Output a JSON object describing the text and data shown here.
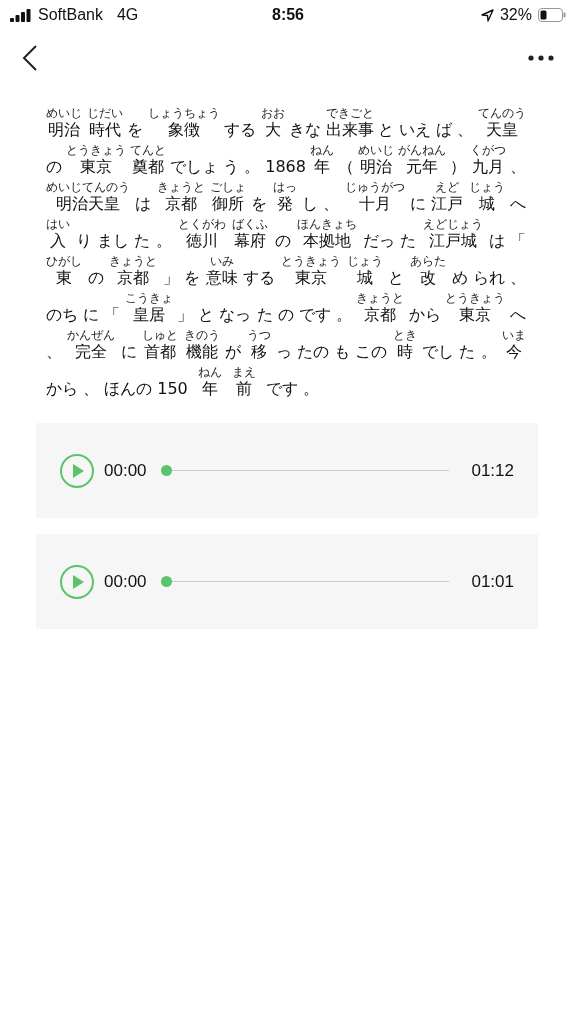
{
  "status_bar": {
    "carrier": "SoftBank",
    "network": "4G",
    "time": "8:56",
    "battery": "32%"
  },
  "article": {
    "lines": [
      [
        {
          "text": "明治",
          "ruby": "めいじ"
        },
        {
          "text": "時代",
          "ruby": "じだい"
        },
        {
          "text": "を"
        },
        {
          "text": "象徴",
          "ruby": "しょうちょう"
        },
        {
          "text": "する"
        },
        {
          "text": "大",
          "ruby": "おお"
        },
        {
          "text": "きな"
        },
        {
          "text": "出来事",
          "ruby": "できごと"
        },
        {
          "text": "と いえ ば 、"
        },
        {
          "text": "天皇",
          "ruby": "てんのう"
        }
      ],
      [
        {
          "text": "の"
        },
        {
          "text": "東京",
          "ruby": "とうきょう"
        },
        {
          "text": "奠都",
          "ruby": "てんと"
        },
        {
          "text": "でしょ う 。 1868"
        },
        {
          "text": "年",
          "ruby": "ねん"
        },
        {
          "text": "（"
        },
        {
          "text": "明治",
          "ruby": "めいじ"
        },
        {
          "text": "元年",
          "ruby": "がんねん"
        },
        {
          "text": "）"
        },
        {
          "text": "九月",
          "ruby": "くがつ"
        },
        {
          "text": "、"
        }
      ],
      [
        {
          "text": "明治天皇",
          "ruby": "めいじてんのう"
        },
        {
          "text": "は"
        },
        {
          "text": "京都",
          "ruby": "きょうと"
        },
        {
          "text": "御所",
          "ruby": "ごしょ"
        },
        {
          "text": "を"
        },
        {
          "text": "発",
          "ruby": "はっ"
        },
        {
          "text": "し 、"
        },
        {
          "text": "十月",
          "ruby": "じゅうがつ"
        },
        {
          "text": "に"
        },
        {
          "text": "江戸",
          "ruby": "えど"
        },
        {
          "text": "城",
          "ruby": "じょう"
        },
        {
          "text": "へ"
        }
      ],
      [
        {
          "text": "入",
          "ruby": "はい"
        },
        {
          "text": "り まし た 。"
        },
        {
          "text": "徳川",
          "ruby": "とくがわ"
        },
        {
          "text": "幕府",
          "ruby": "ばくふ"
        },
        {
          "text": "の"
        },
        {
          "text": "本拠地",
          "ruby": "ほんきょち"
        },
        {
          "text": "だっ た"
        },
        {
          "text": "江戸城",
          "ruby": "えどじょう"
        },
        {
          "text": "は 「"
        }
      ],
      [
        {
          "text": "東",
          "ruby": "ひがし"
        },
        {
          "text": "の"
        },
        {
          "text": "京都",
          "ruby": "きょうと"
        },
        {
          "text": "」 を"
        },
        {
          "text": "意味",
          "ruby": "いみ"
        },
        {
          "text": "する"
        },
        {
          "text": "東京",
          "ruby": "とうきょう"
        },
        {
          "text": "城",
          "ruby": "じょう"
        },
        {
          "text": "と"
        },
        {
          "text": "改",
          "ruby": "あらた"
        },
        {
          "text": "め られ 、"
        }
      ],
      [
        {
          "text": "のち に 「"
        },
        {
          "text": "皇居",
          "ruby": "こうきょ"
        },
        {
          "text": "」 と なっ た の です 。"
        },
        {
          "text": "京都",
          "ruby": "きょうと"
        },
        {
          "text": "から"
        },
        {
          "text": "東京",
          "ruby": "とうきょう"
        },
        {
          "text": "へ"
        }
      ],
      [
        {
          "text": "、"
        },
        {
          "text": "完全",
          "ruby": "かんぜん"
        },
        {
          "text": "に"
        },
        {
          "text": "首都",
          "ruby": "しゅと"
        },
        {
          "text": "機能",
          "ruby": "きのう"
        },
        {
          "text": "が"
        },
        {
          "text": "移",
          "ruby": "うつ"
        },
        {
          "text": "っ たの も この"
        },
        {
          "text": "時",
          "ruby": "とき"
        },
        {
          "text": "でし た 。"
        },
        {
          "text": "今",
          "ruby": "いま"
        }
      ],
      [
        {
          "text": "から 、 ほんの 150"
        },
        {
          "text": "年",
          "ruby": "ねん"
        },
        {
          "text": "前",
          "ruby": "まえ"
        },
        {
          "text": "です 。"
        }
      ]
    ]
  },
  "audio_players": [
    {
      "current": "00:00",
      "level": 0,
      "duration": "01:12"
    },
    {
      "current": "00:00",
      "level": 0,
      "duration": "01:01"
    }
  ]
}
